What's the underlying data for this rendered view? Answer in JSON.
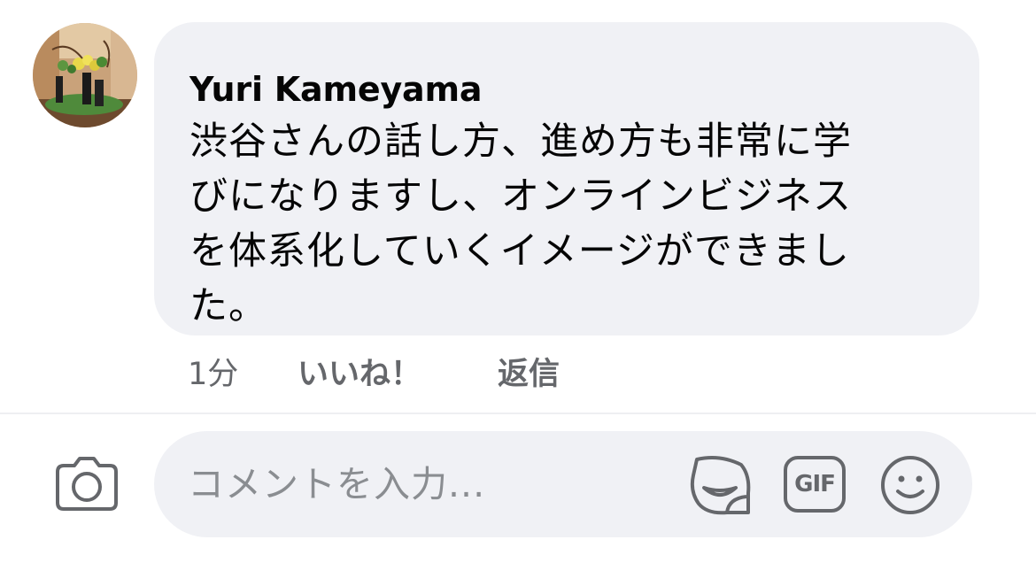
{
  "comment": {
    "author": "Yuri Kameyama",
    "lines": [
      "渋谷さんの話し方、進め方も非常に学",
      "びになりますし、オンラインビジネス",
      "を体系化していくイメージができまし",
      "た。"
    ],
    "time": "1分",
    "like_label": "いいね！",
    "reply_label": "返信"
  },
  "composer": {
    "placeholder": "コメントを入力...",
    "gif_label": "GIF",
    "icons": [
      "camera-icon",
      "sticker-icon",
      "gif-icon",
      "emoji-icon"
    ]
  },
  "colors": {
    "bubble_bg": "#f0f1f5",
    "text_primary": "#050505",
    "text_secondary": "#65676b",
    "placeholder": "#8a8d91"
  }
}
